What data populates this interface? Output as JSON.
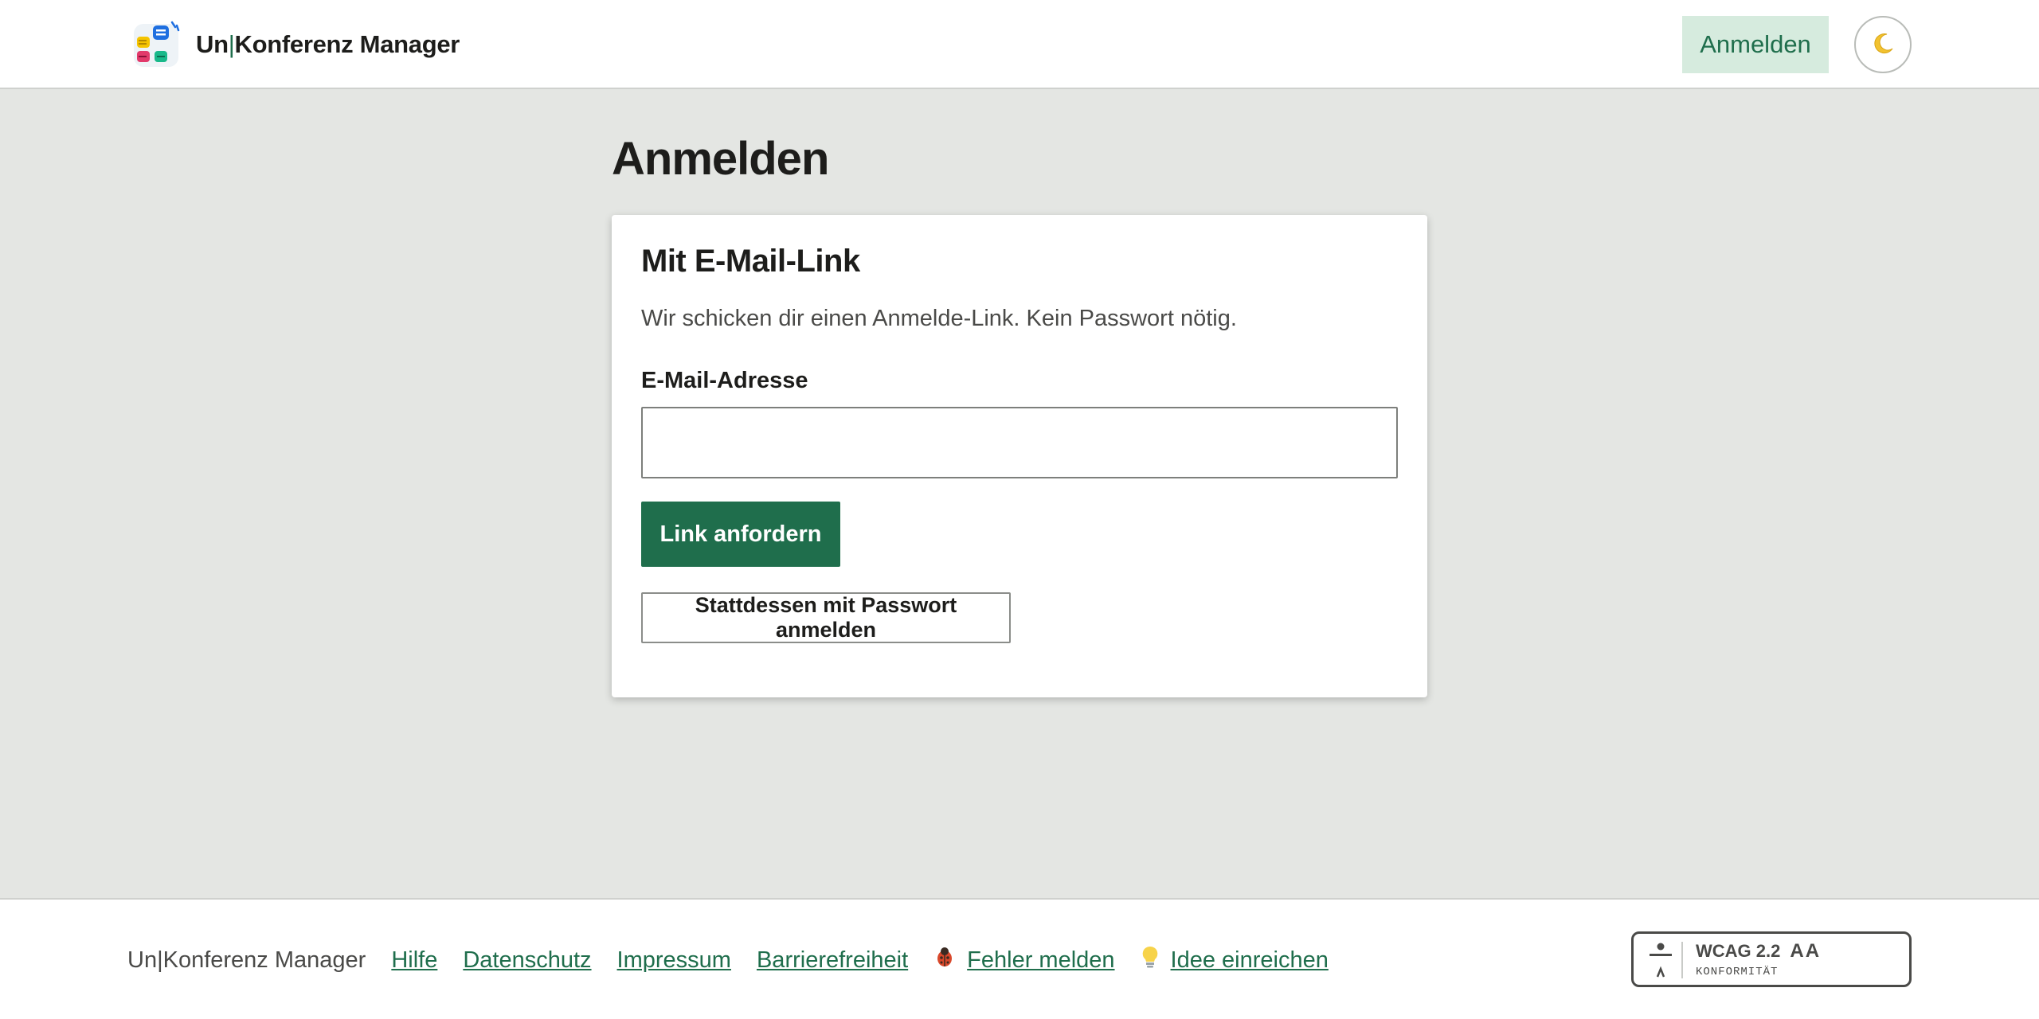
{
  "header": {
    "brand_prefix": "Un",
    "brand_separator": "|",
    "brand_suffix": "Konferenz Manager",
    "login_label": "Anmelden",
    "theme_toggle_icon": "moon-icon"
  },
  "main": {
    "page_title": "Anmelden",
    "card": {
      "title": "Mit E-Mail-Link",
      "description": "Wir schicken dir einen Anmelde-Link. Kein Passwort nötig.",
      "email_label": "E-Mail-Adresse",
      "email_value": "",
      "submit_label": "Link anfordern",
      "password_login_label": "Stattdessen mit Passwort anmelden"
    }
  },
  "footer": {
    "brand": "Un|Konferenz Manager",
    "links": {
      "help": "Hilfe",
      "privacy": "Datenschutz",
      "imprint": "Impressum",
      "accessibility": "Barrierefreiheit",
      "report_bug": "Fehler melden",
      "submit_idea": "Idee einreichen"
    },
    "report_bug_icon": "bug-icon",
    "submit_idea_icon": "lightbulb-icon",
    "wcag": {
      "title": "WCAG 2.2",
      "level": "AA",
      "subtitle": "KONFORMITÄT"
    }
  },
  "colors": {
    "accent": "#1f6e4c",
    "accent_light": "#d6ebde",
    "page_background": "#e4e6e3"
  }
}
